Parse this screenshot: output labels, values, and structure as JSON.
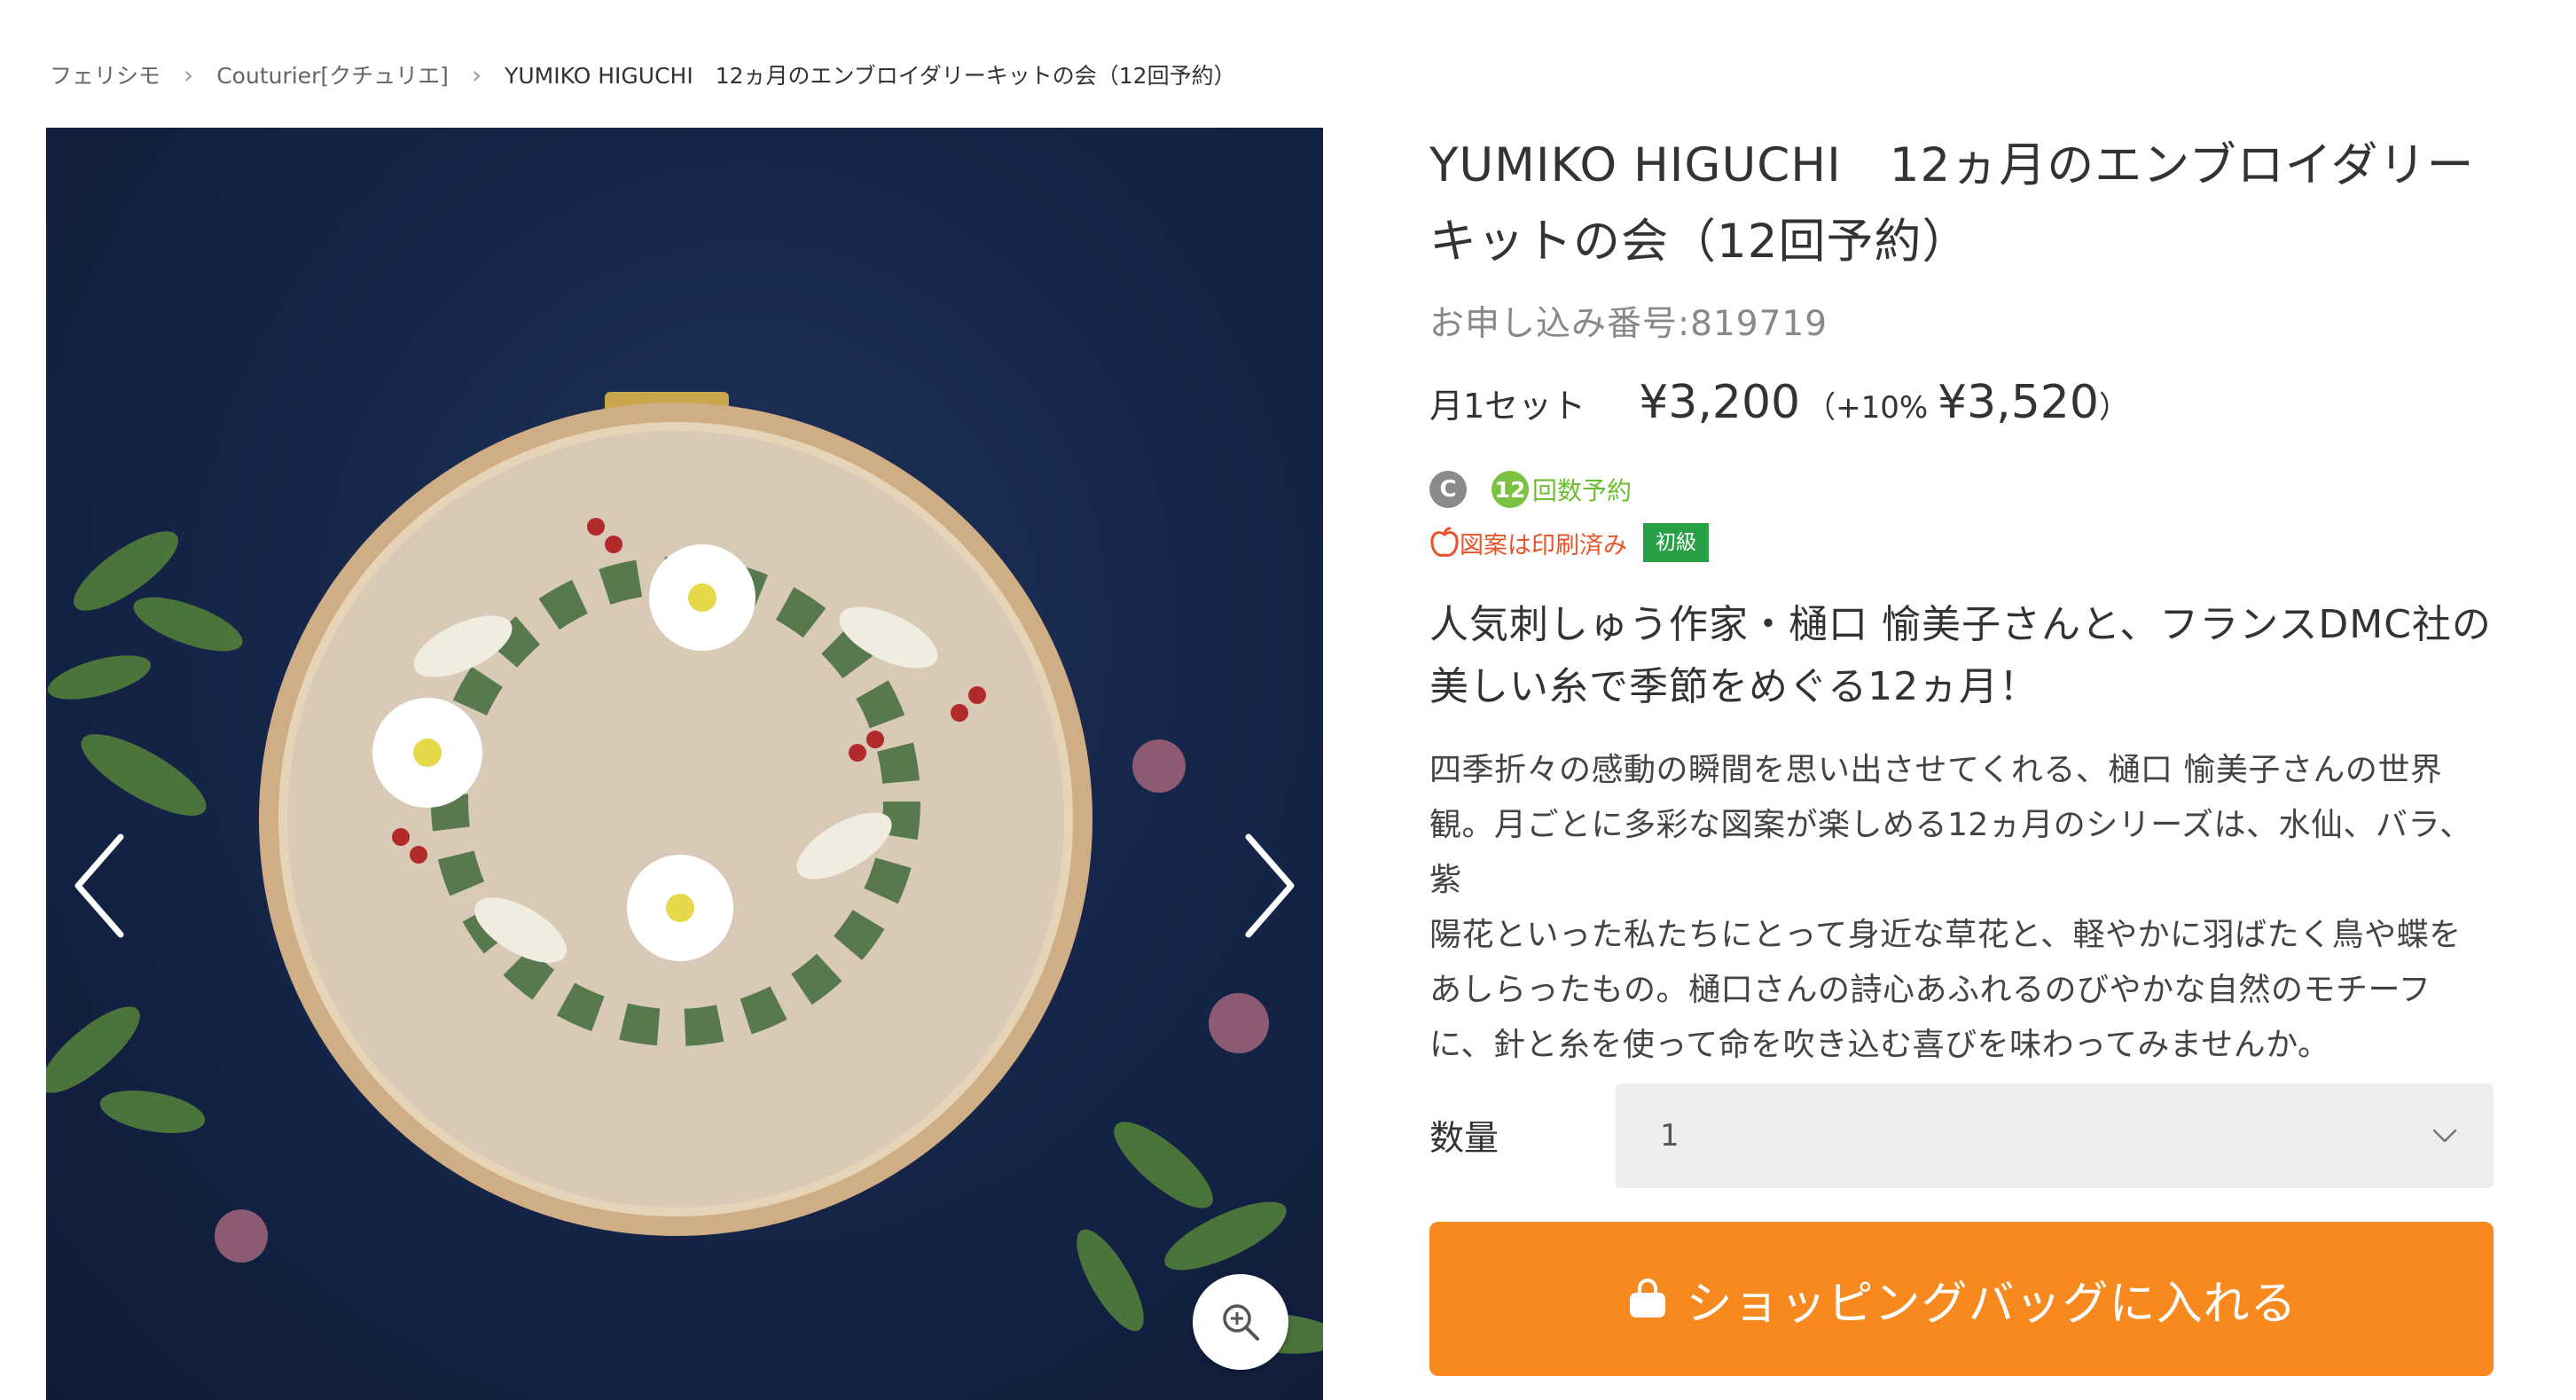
{
  "breadcrumb": {
    "items": [
      "フェリシモ",
      "Couturier[クチュリエ]"
    ],
    "current": "YUMIKO HIGUCHI　12ヵ月のエンブロイダリーキットの会（12回予約）"
  },
  "product": {
    "title_line1": "YUMIKO HIGUCHI　12ヵ月のエンブロイダリー",
    "title_line2": "キットの会（12回予約）",
    "order_number": "お申し込み番号:819719",
    "price_unit": "月1セット",
    "price": "¥3,200",
    "tax_prefix": "（+10%",
    "tax_price": "¥3,520",
    "tax_suffix": "）",
    "badge_c": "C",
    "count_number": "12",
    "count_label": "回数予約",
    "printed_label": "図案は印刷済み",
    "level_label": "初級",
    "catch_line1": "人気刺しゅう作家・樋口 愉美子さんと、フランスDMC社の",
    "catch_line2": "美しい糸で季節をめぐる12ヵ月！",
    "description_lines": [
      "四季折々の感動の瞬間を思い出させてくれる、樋口 愉美子さんの世界",
      "観。月ごとに多彩な図案が楽しめる12ヵ月のシリーズは、水仙、バラ、紫",
      "陽花といった私たちにとって身近な草花と、軽やかに羽ばたく鳥や蝶を",
      "あしらったもの。樋口さんの詩心あふれるのびやかな自然のモチーフ",
      "に、針と糸を使って命を吹き込む喜びを味わってみませんか。"
    ]
  },
  "quantity": {
    "label": "数量",
    "value": "1"
  },
  "cart_button": {
    "label": "ショッピングバッグに入れる"
  },
  "colors": {
    "accent": "#f7891e",
    "level_green": "#27a046",
    "count_green": "#7cc242",
    "printed_red": "#e8542a"
  },
  "icons": [
    "chevron-left-icon",
    "chevron-right-icon",
    "zoom-in-icon",
    "chevron-down-icon",
    "shopping-bag-icon",
    "apple-icon"
  ]
}
